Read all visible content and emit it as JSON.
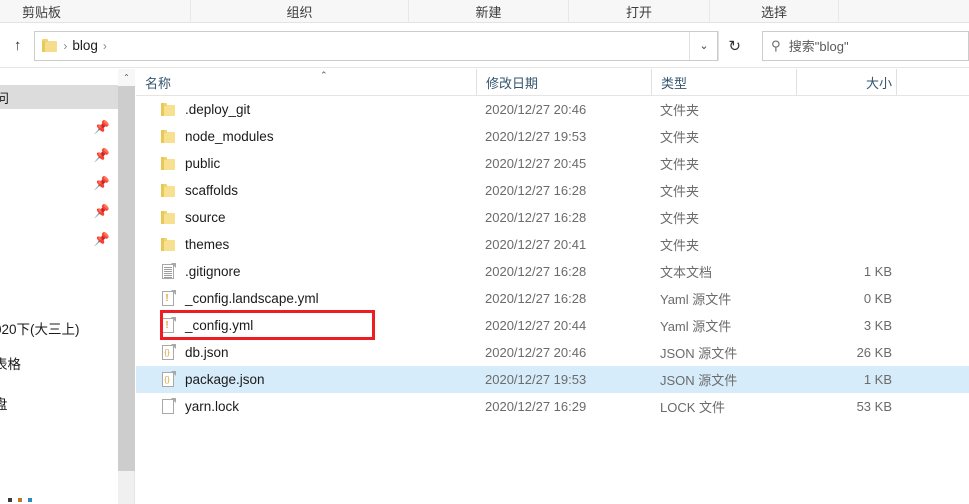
{
  "ribbon": {
    "groups": [
      {
        "label": "剪贴板",
        "name": "ribbon-group-clipboard"
      },
      {
        "label": "组织",
        "name": "ribbon-group-organize"
      },
      {
        "label": "新建",
        "name": "ribbon-group-new"
      },
      {
        "label": "打开",
        "name": "ribbon-group-open"
      },
      {
        "label": "选择",
        "name": "ribbon-group-select"
      }
    ]
  },
  "addressbar": {
    "up_icon": "↑",
    "breadcrumb_icon": "folder-icon",
    "breadcrumb_sep": "›",
    "breadcrumb": "blog",
    "dropdown_icon": "⌄",
    "refresh_icon": "↻"
  },
  "search": {
    "icon": "search-icon",
    "placeholder": "搜索\"blog\""
  },
  "navpane": {
    "quick_access_header": "问",
    "rows": [
      {
        "label": "",
        "pin": "📌"
      },
      {
        "label": "",
        "pin": "📌"
      },
      {
        "label": "",
        "pin": "📌"
      },
      {
        "label": "",
        "pin": "📌"
      },
      {
        "label": "",
        "pin": "📌",
        "accent": true
      },
      {
        "label": "020下(大三上)"
      },
      {
        "label": "表格"
      },
      {
        "label": "盘"
      }
    ]
  },
  "scrollbar": {
    "up_arrow": "⌃"
  },
  "columns": {
    "name": "名称",
    "date": "修改日期",
    "type": "类型",
    "size": "大小",
    "sort_caret": "⌃"
  },
  "files": [
    {
      "name": ".deploy_git",
      "icon": "folder-icon",
      "date": "2020/12/27 20:46",
      "type": "文件夹",
      "size": ""
    },
    {
      "name": "node_modules",
      "icon": "folder-icon",
      "date": "2020/12/27 19:53",
      "type": "文件夹",
      "size": ""
    },
    {
      "name": "public",
      "icon": "folder-icon",
      "date": "2020/12/27 20:45",
      "type": "文件夹",
      "size": ""
    },
    {
      "name": "scaffolds",
      "icon": "folder-icon",
      "date": "2020/12/27 16:28",
      "type": "文件夹",
      "size": ""
    },
    {
      "name": "source",
      "icon": "folder-icon",
      "date": "2020/12/27 16:28",
      "type": "文件夹",
      "size": ""
    },
    {
      "name": "themes",
      "icon": "folder-icon",
      "date": "2020/12/27 20:41",
      "type": "文件夹",
      "size": ""
    },
    {
      "name": ".gitignore",
      "icon": "text-file-icon",
      "date": "2020/12/27 16:28",
      "type": "文本文档",
      "size": "1 KB"
    },
    {
      "name": "_config.landscape.yml",
      "icon": "yaml-file-icon",
      "date": "2020/12/27 16:28",
      "type": "Yaml 源文件",
      "size": "0 KB"
    },
    {
      "name": "_config.yml",
      "icon": "yaml-file-icon",
      "date": "2020/12/27 20:44",
      "type": "Yaml 源文件",
      "size": "3 KB",
      "highlighted": true
    },
    {
      "name": "db.json",
      "icon": "json-file-icon",
      "date": "2020/12/27 20:46",
      "type": "JSON 源文件",
      "size": "26 KB"
    },
    {
      "name": "package.json",
      "icon": "json-file-icon",
      "date": "2020/12/27 19:53",
      "type": "JSON 源文件",
      "size": "1 KB",
      "selected": true
    },
    {
      "name": "yarn.lock",
      "icon": "lock-file-icon",
      "date": "2020/12/27 16:29",
      "type": "LOCK 文件",
      "size": "53 KB"
    }
  ],
  "annotation": {
    "color": "#ee1d23",
    "target": "_config.yml"
  },
  "colors": {
    "selection": "#d7ecfb",
    "header_text": "#33556e",
    "folder": "#f7e08f",
    "accent_red": "#ee1d23"
  }
}
